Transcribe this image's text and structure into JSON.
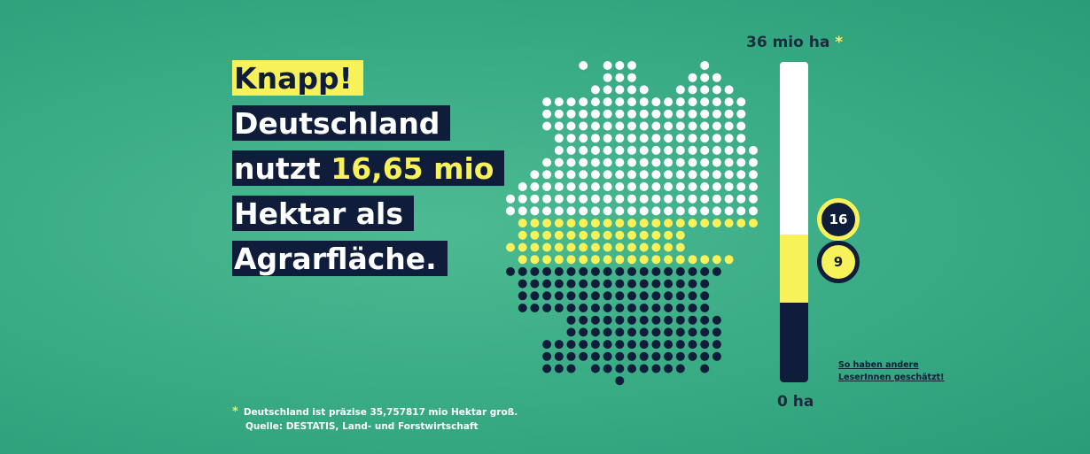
{
  "headline": {
    "line1": "Knapp!",
    "line2": "Deutschland",
    "line3_prefix": "nutzt ",
    "line3_highlight": "16,65 mio",
    "line4": "Hektar als",
    "line5": "Agrarfläche."
  },
  "footnote": {
    "star": "*",
    "line1": "Deutschland ist präzise 35,757817 mio Hektar groß.",
    "line2": "Quelle: DESTATIS, Land- und Forstwirtschaft"
  },
  "scale": {
    "max_label": "36 mio ha",
    "max_star": "*",
    "min_label": "0 ha",
    "max_value": 36,
    "actual_value": 16.65,
    "guess_value": 9
  },
  "markers": {
    "actual": "16",
    "guess": "9"
  },
  "link": {
    "line1": "So haben andere",
    "line2": "LeserInnen geschätzt!"
  },
  "colors": {
    "background": "#3db38a",
    "navy": "#0f1d3a",
    "yellow": "#f8f25a",
    "white": "#ffffff"
  }
}
